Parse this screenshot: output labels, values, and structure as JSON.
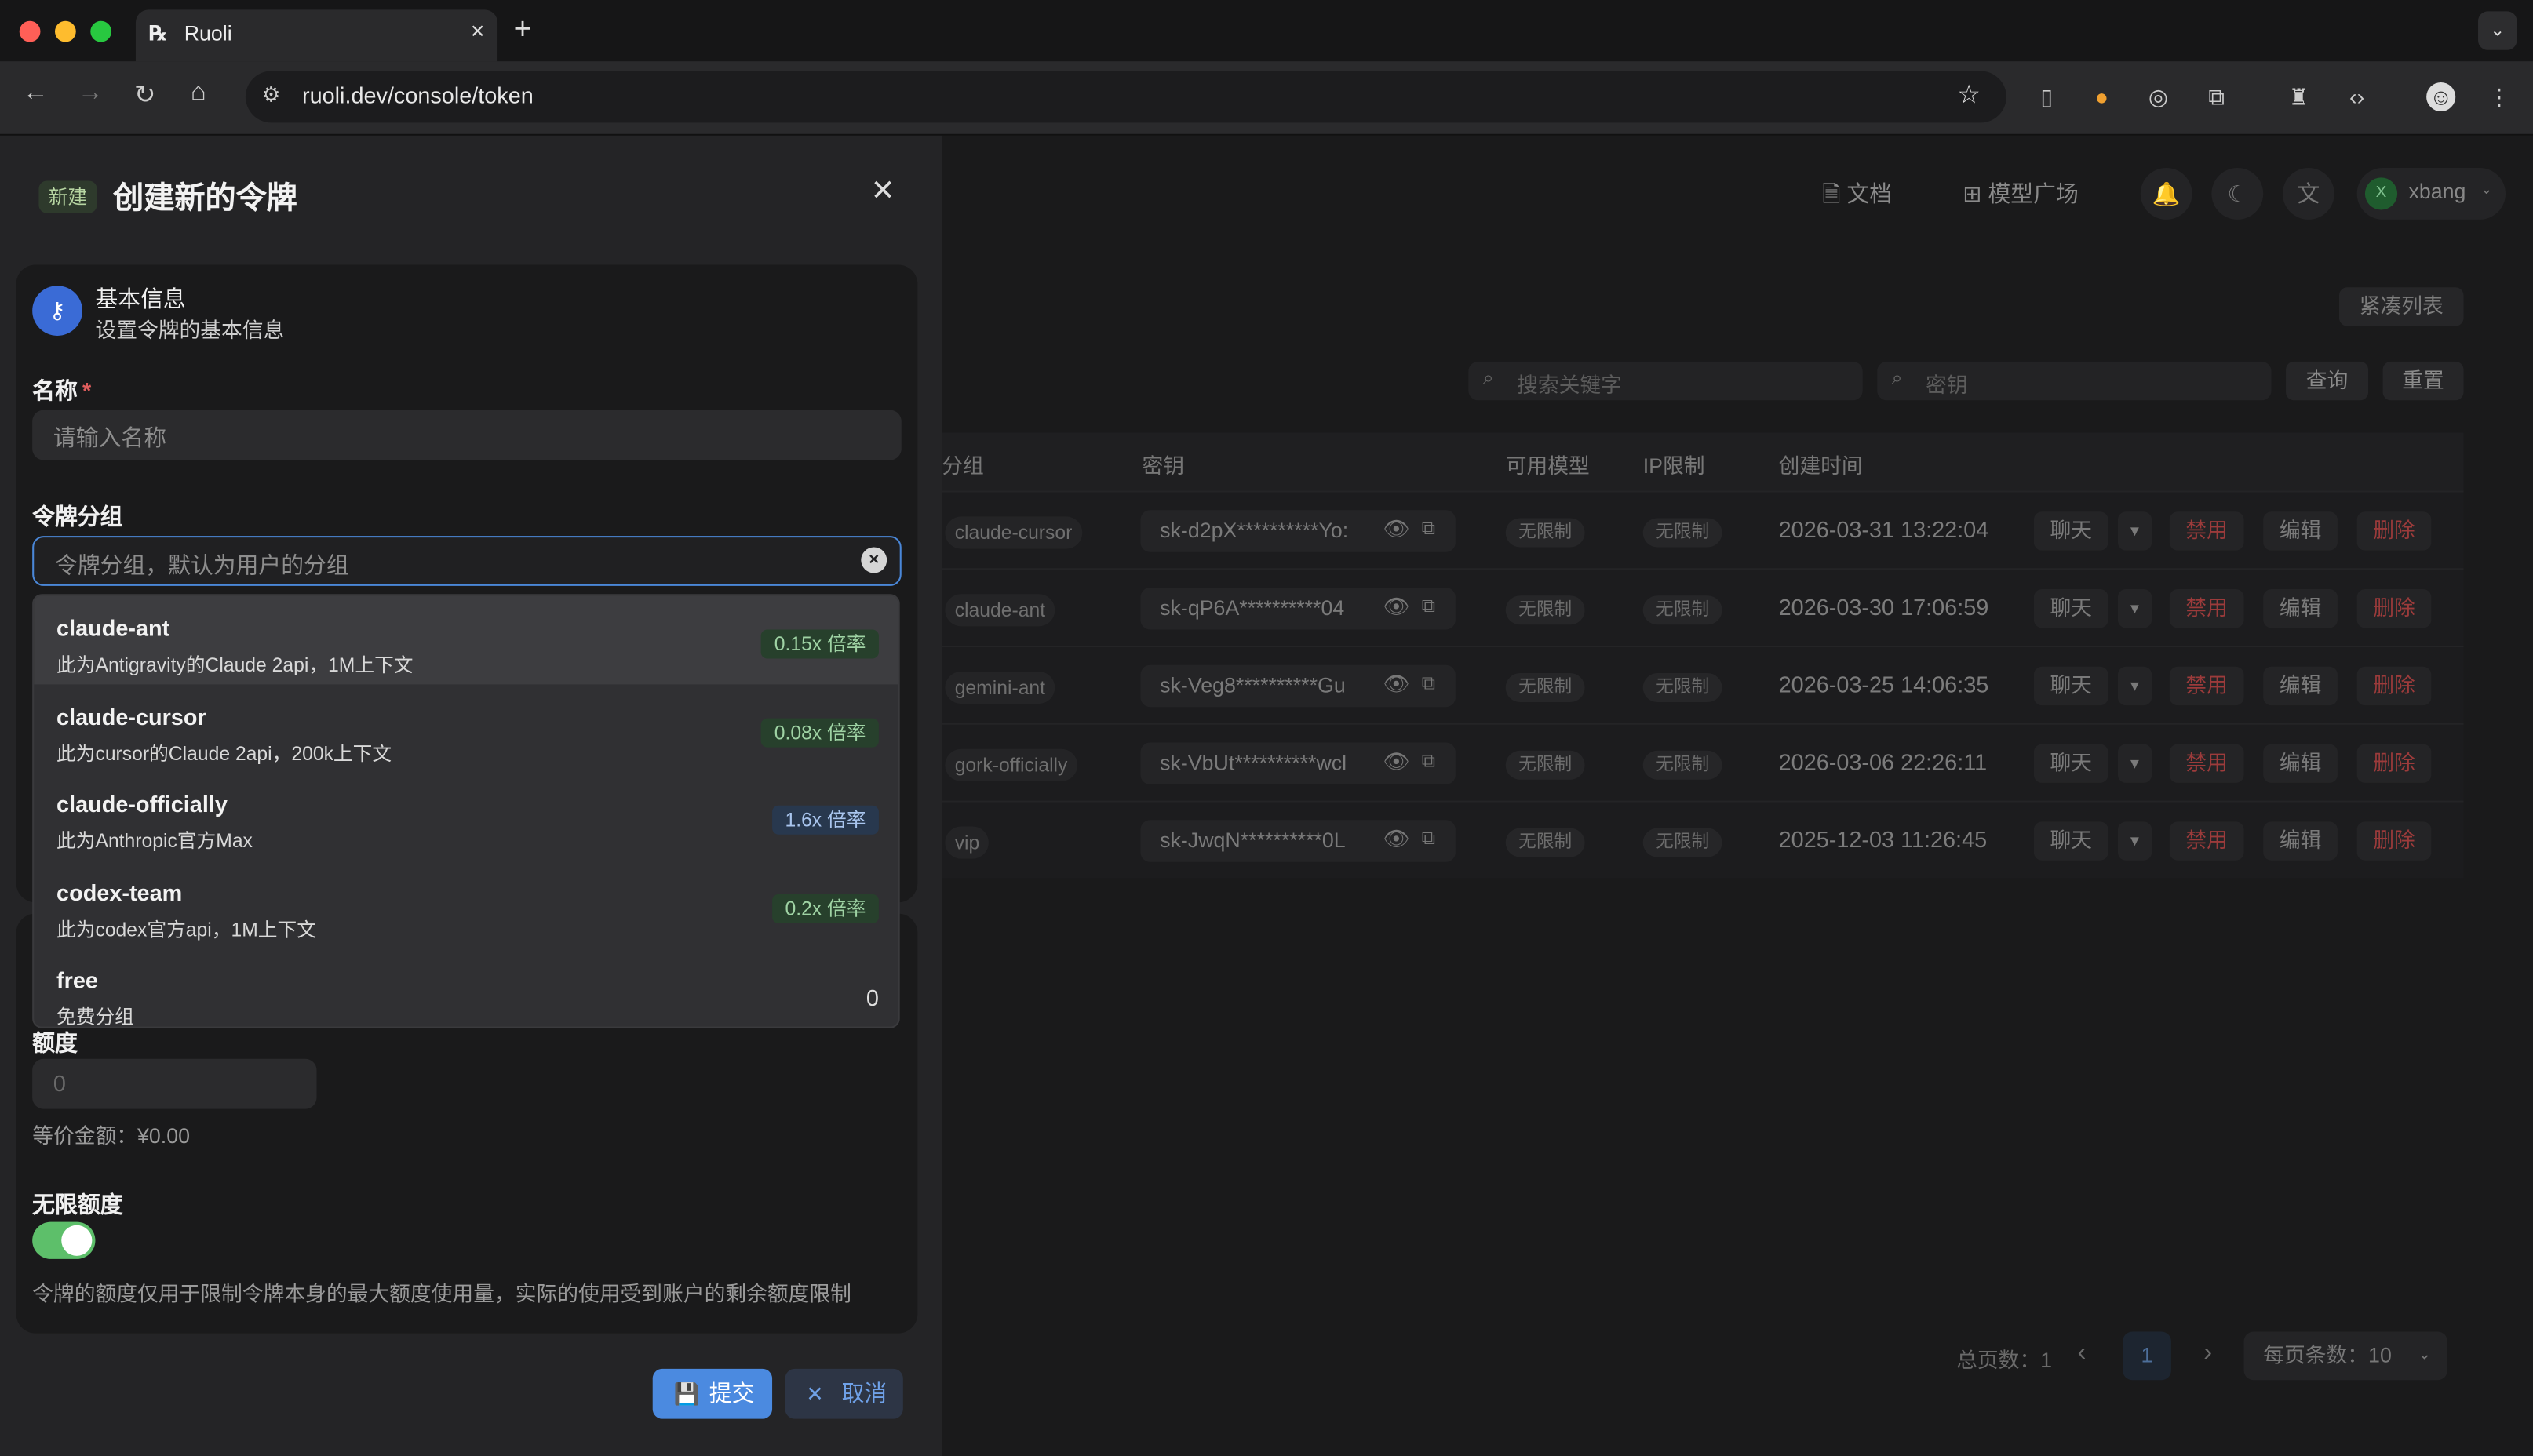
{
  "browser": {
    "tab_title": "Ruoli",
    "url": "ruoli.dev/console/token",
    "accent_traffic": [
      "#ff5f57",
      "#febc2e",
      "#28c840"
    ]
  },
  "topnav": {
    "docs_label": "文档",
    "model_plaza_label": "模型广场",
    "user_name": "xbang",
    "user_initial": "X"
  },
  "toolbar": {
    "compact_list_label": "紧凑列表",
    "search_keyword_placeholder": "搜索关键字",
    "search_key_placeholder": "密钥",
    "query_label": "查询",
    "reset_label": "重置"
  },
  "table": {
    "headers": [
      "分组",
      "密钥",
      "可用模型",
      "IP限制",
      "创建时间"
    ],
    "rows": [
      {
        "group": "claude-cursor",
        "key": "sk-d2pX**********Yo:",
        "models": "无限制",
        "ip": "无限制",
        "created": "2026-03-31 13:22:04"
      },
      {
        "group": "claude-ant",
        "key": "sk-qP6A**********04",
        "models": "无限制",
        "ip": "无限制",
        "created": "2026-03-30 17:06:59"
      },
      {
        "group": "gemini-ant",
        "key": "sk-Veg8**********Gu",
        "models": "无限制",
        "ip": "无限制",
        "created": "2026-03-25 14:06:35"
      },
      {
        "group": "gork-officially",
        "key": "sk-VbUt**********wcl",
        "models": "无限制",
        "ip": "无限制",
        "created": "2026-03-06 22:26:11"
      },
      {
        "group": "vip",
        "key": "sk-JwqN**********0L",
        "models": "无限制",
        "ip": "无限制",
        "created": "2025-12-03 11:26:45"
      }
    ],
    "actions": {
      "chat": "聊天",
      "ban": "禁用",
      "edit": "编辑",
      "delete": "删除"
    }
  },
  "pagination": {
    "total_label": "总页数：1",
    "current_page": "1",
    "page_size_label": "每页条数：10"
  },
  "sheet": {
    "badge": "新建",
    "title": "创建新的令牌",
    "basic": {
      "title": "基本信息",
      "subtitle": "设置令牌的基本信息"
    },
    "name_label": "名称",
    "name_required": "*",
    "name_placeholder": "请输入名称",
    "group_label": "令牌分组",
    "group_placeholder": "令牌分组，默认为用户的分组",
    "group_options": [
      {
        "name": "claude-ant",
        "desc": "此为Antigravity的Claude 2api，1M上下文",
        "rate": "0.15x 倍率",
        "rate_color": "green"
      },
      {
        "name": "claude-cursor",
        "desc": "此为cursor的Claude 2api，200k上下文",
        "rate": "0.08x 倍率",
        "rate_color": "green"
      },
      {
        "name": "claude-officially",
        "desc": "此为Anthropic官方Max",
        "rate": "1.6x 倍率",
        "rate_color": "blue"
      },
      {
        "name": "codex-team",
        "desc": "此为codex官方api，1M上下文",
        "rate": "0.2x 倍率",
        "rate_color": "green"
      },
      {
        "name": "free",
        "desc": "免费分组",
        "rate": "0",
        "rate_color": "none"
      }
    ],
    "quota_label": "额度",
    "quota_placeholder": "0",
    "equivalent_label": "等价金额：¥0.00",
    "unlimited_label": "无限额度",
    "unlimited_enabled": true,
    "note": "令牌的额度仅用于限制令牌本身的最大额度使用量，实际的使用受到账户的剩余额度限制",
    "submit_label": "提交",
    "cancel_label": "取消"
  }
}
